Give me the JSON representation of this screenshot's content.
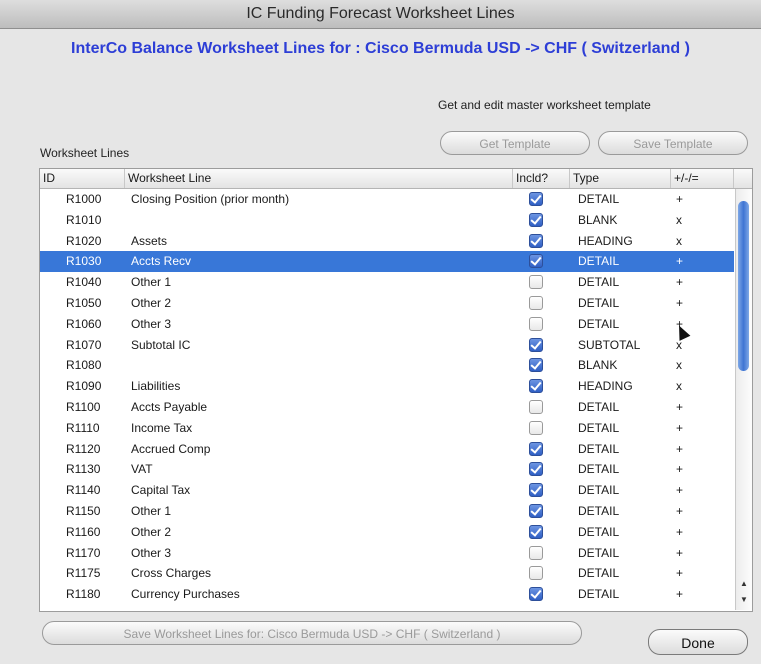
{
  "window": {
    "title": "IC Funding Forecast Worksheet Lines"
  },
  "subtitle": "InterCo Balance Worksheet Lines for : Cisco Bermuda USD -> CHF ( Switzerland )",
  "template": {
    "label": "Get and edit master worksheet template",
    "get_button": "Get Template",
    "save_button": "Save Template"
  },
  "worksheet_label": "Worksheet Lines",
  "columns": [
    "ID",
    "Worksheet Line",
    "Incld?",
    "Type",
    "+/-/="
  ],
  "rows": [
    {
      "id": "R1000",
      "line": "Closing Position (prior month)",
      "incl": true,
      "type": "DETAIL",
      "pm": "+"
    },
    {
      "id": "R1010",
      "line": "",
      "incl": true,
      "type": "BLANK",
      "pm": "x"
    },
    {
      "id": "R1020",
      "line": "Assets",
      "incl": true,
      "type": "HEADING",
      "pm": "x"
    },
    {
      "id": "R1030",
      "line": "Accts Recv",
      "incl": true,
      "type": "DETAIL",
      "pm": "+",
      "selected": true
    },
    {
      "id": "R1040",
      "line": "Other 1",
      "incl": false,
      "type": "DETAIL",
      "pm": "+"
    },
    {
      "id": "R1050",
      "line": "Other 2",
      "incl": false,
      "type": "DETAIL",
      "pm": "+"
    },
    {
      "id": "R1060",
      "line": "Other 3",
      "incl": false,
      "type": "DETAIL",
      "pm": "+"
    },
    {
      "id": "R1070",
      "line": "Subtotal IC",
      "incl": true,
      "type": "SUBTOTAL",
      "pm": "x"
    },
    {
      "id": "R1080",
      "line": "",
      "incl": true,
      "type": "BLANK",
      "pm": "x"
    },
    {
      "id": "R1090",
      "line": "Liabilities",
      "incl": true,
      "type": "HEADING",
      "pm": "x"
    },
    {
      "id": "R1100",
      "line": "Accts Payable",
      "incl": false,
      "type": "DETAIL",
      "pm": "+"
    },
    {
      "id": "R1110",
      "line": "Income Tax",
      "incl": false,
      "type": "DETAIL",
      "pm": "+"
    },
    {
      "id": "R1120",
      "line": "Accrued Comp",
      "incl": true,
      "type": "DETAIL",
      "pm": "+"
    },
    {
      "id": "R1130",
      "line": "VAT",
      "incl": true,
      "type": "DETAIL",
      "pm": "+"
    },
    {
      "id": "R1140",
      "line": "Capital Tax",
      "incl": true,
      "type": "DETAIL",
      "pm": "+"
    },
    {
      "id": "R1150",
      "line": "Other 1",
      "incl": true,
      "type": "DETAIL",
      "pm": "+"
    },
    {
      "id": "R1160",
      "line": "Other 2",
      "incl": true,
      "type": "DETAIL",
      "pm": "+"
    },
    {
      "id": "R1170",
      "line": "Other 3",
      "incl": false,
      "type": "DETAIL",
      "pm": "+"
    },
    {
      "id": "R1175",
      "line": "Cross Charges",
      "incl": false,
      "type": "DETAIL",
      "pm": "+"
    },
    {
      "id": "R1180",
      "line": "Currency Purchases",
      "incl": true,
      "type": "DETAIL",
      "pm": "+"
    }
  ],
  "footer": {
    "save_lines_button": "Save Worksheet Lines for: Cisco Bermuda USD -> CHF ( Switzerland )",
    "done_button": "Done"
  },
  "icons": {
    "scroll_up": "triangle-up",
    "scroll_down": "triangle-down"
  },
  "colors": {
    "accent": "#3877d8",
    "subtitle": "#2d3ed6"
  }
}
